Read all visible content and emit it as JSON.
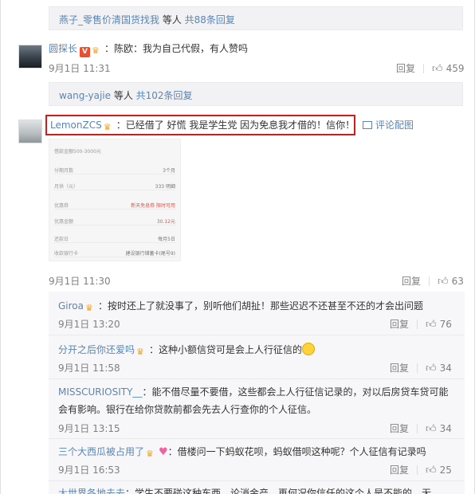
{
  "top_more": {
    "user": "燕子_零售价清国货找我",
    "suffix": " 等人 ",
    "count": "共88条回复"
  },
  "c1": {
    "name": "圆探长",
    "text": "：陈欧：我为自己代假，有人赞吗",
    "time": "9月1日 11:31",
    "reply": "回复",
    "likes": "459"
  },
  "more2": {
    "user": "wang-yajie",
    "suffix": " 等人 ",
    "count": "共102条回复"
  },
  "c2": {
    "name": "LemonZCS",
    "text": "：已经借了 好慌 我是学生党  因为免息我才借的！信你！",
    "image_link": "评论配图",
    "time": "9月1日 11:30",
    "reply": "回复",
    "likes": "63"
  },
  "img": {
    "caption": "借款金额500-3000元",
    "rows": [
      {
        "k": "分期月数",
        "v": "3个月"
      },
      {
        "k": "月供（元）",
        "v": "333 明细"
      },
      {
        "k": "优惠券",
        "v": "新天免息券 限时可用"
      },
      {
        "k": "优惠金额",
        "v": "30.12元"
      },
      {
        "k": "还款日",
        "v": "每月5日"
      },
      {
        "k": "收款银行卡",
        "v": "建设银行储蓄卡(尾号9)"
      }
    ]
  },
  "replies": [
    {
      "name": "Giroa",
      "text": "：按时还上了就没事了，别听他们胡扯！那些迟迟不还甚至不还的才会出问题",
      "time": "9月1日 13:20",
      "reply": "回复",
      "likes": "76"
    },
    {
      "name": "分开之后你还爱吗",
      "text": "：这种小额信贷可是会上人行征信的",
      "time": "9月1日 11:58",
      "reply": "回复",
      "likes": "34"
    },
    {
      "name": "MISSCURIOSITY__",
      "text": "：能不借尽量不要借，这些都会上人行征信记录的，对以后房贷车贷可能",
      "text2": "会有影响。银行在给你贷款前都会先去人行查你的个人征信。",
      "time": "9月1日 13:15",
      "reply": "回复",
      "likes": "34"
    },
    {
      "name": "三个大西瓜被占用了",
      "text": "：借楼问一下蚂蚁花呗，蚂蚁借呗这种呢？个人征信有记录吗",
      "time": "9月1日 16:53",
      "reply": "回复",
      "likes": "25"
    },
    {
      "name": "大世界各地去去",
      "text": "：学生不要碰这种东西，论消金产，再何况你信任的这个人是不能的，无"
    }
  ]
}
